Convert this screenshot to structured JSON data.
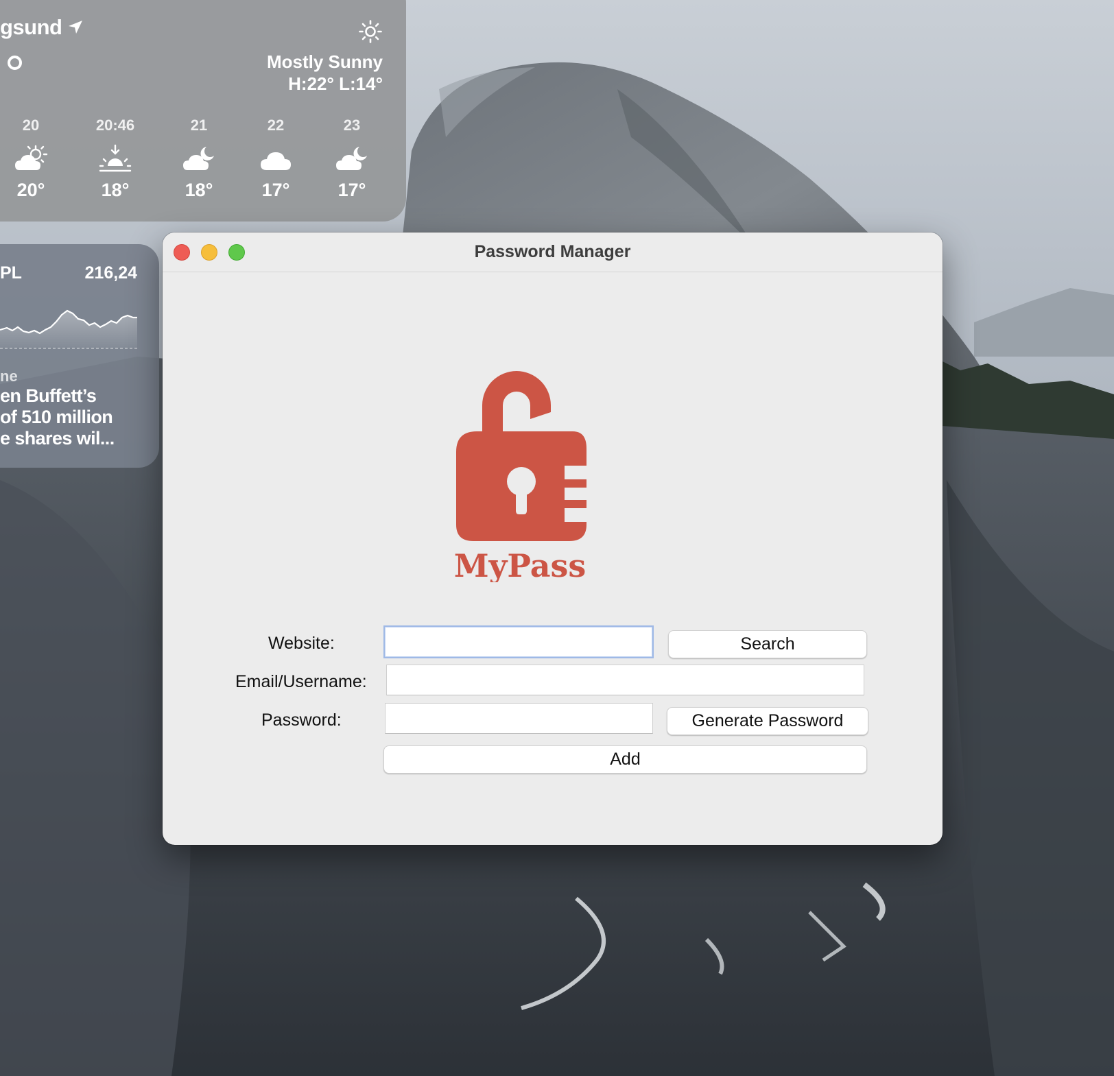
{
  "desktop": {
    "wallpaper": "mountain-cliff-wallpaper"
  },
  "weather": {
    "city": "gsund",
    "current_temp": "0",
    "condition": "Mostly Sunny",
    "high_low": "H:22° L:14°",
    "icon": "sun-icon",
    "forecast": [
      {
        "hour": "20",
        "icon": "partly-sunny-icon",
        "temp": "20°"
      },
      {
        "hour": "20:46",
        "icon": "sunset-icon",
        "temp": "18°"
      },
      {
        "hour": "21",
        "icon": "partly-cloudy-night-icon",
        "temp": "18°"
      },
      {
        "hour": "22",
        "icon": "cloud-icon",
        "temp": "17°"
      },
      {
        "hour": "23",
        "icon": "partly-cloudy-night-icon",
        "temp": "17°"
      }
    ]
  },
  "stocks": {
    "symbol": "PL",
    "price": "216,24",
    "news_source": "ne",
    "news_headline": "en Buffett’s\nof 510 million\ne shares wil..."
  },
  "window": {
    "title": "Password Manager",
    "logo_text": "MyPass",
    "accent_color": "#cc5545",
    "form": {
      "website_label": "Website:",
      "website_value": "",
      "email_label": "Email/Username:",
      "email_value": "",
      "password_label": "Password:",
      "password_value": "",
      "search_button": "Search",
      "generate_button": "Generate Password",
      "add_button": "Add"
    }
  }
}
